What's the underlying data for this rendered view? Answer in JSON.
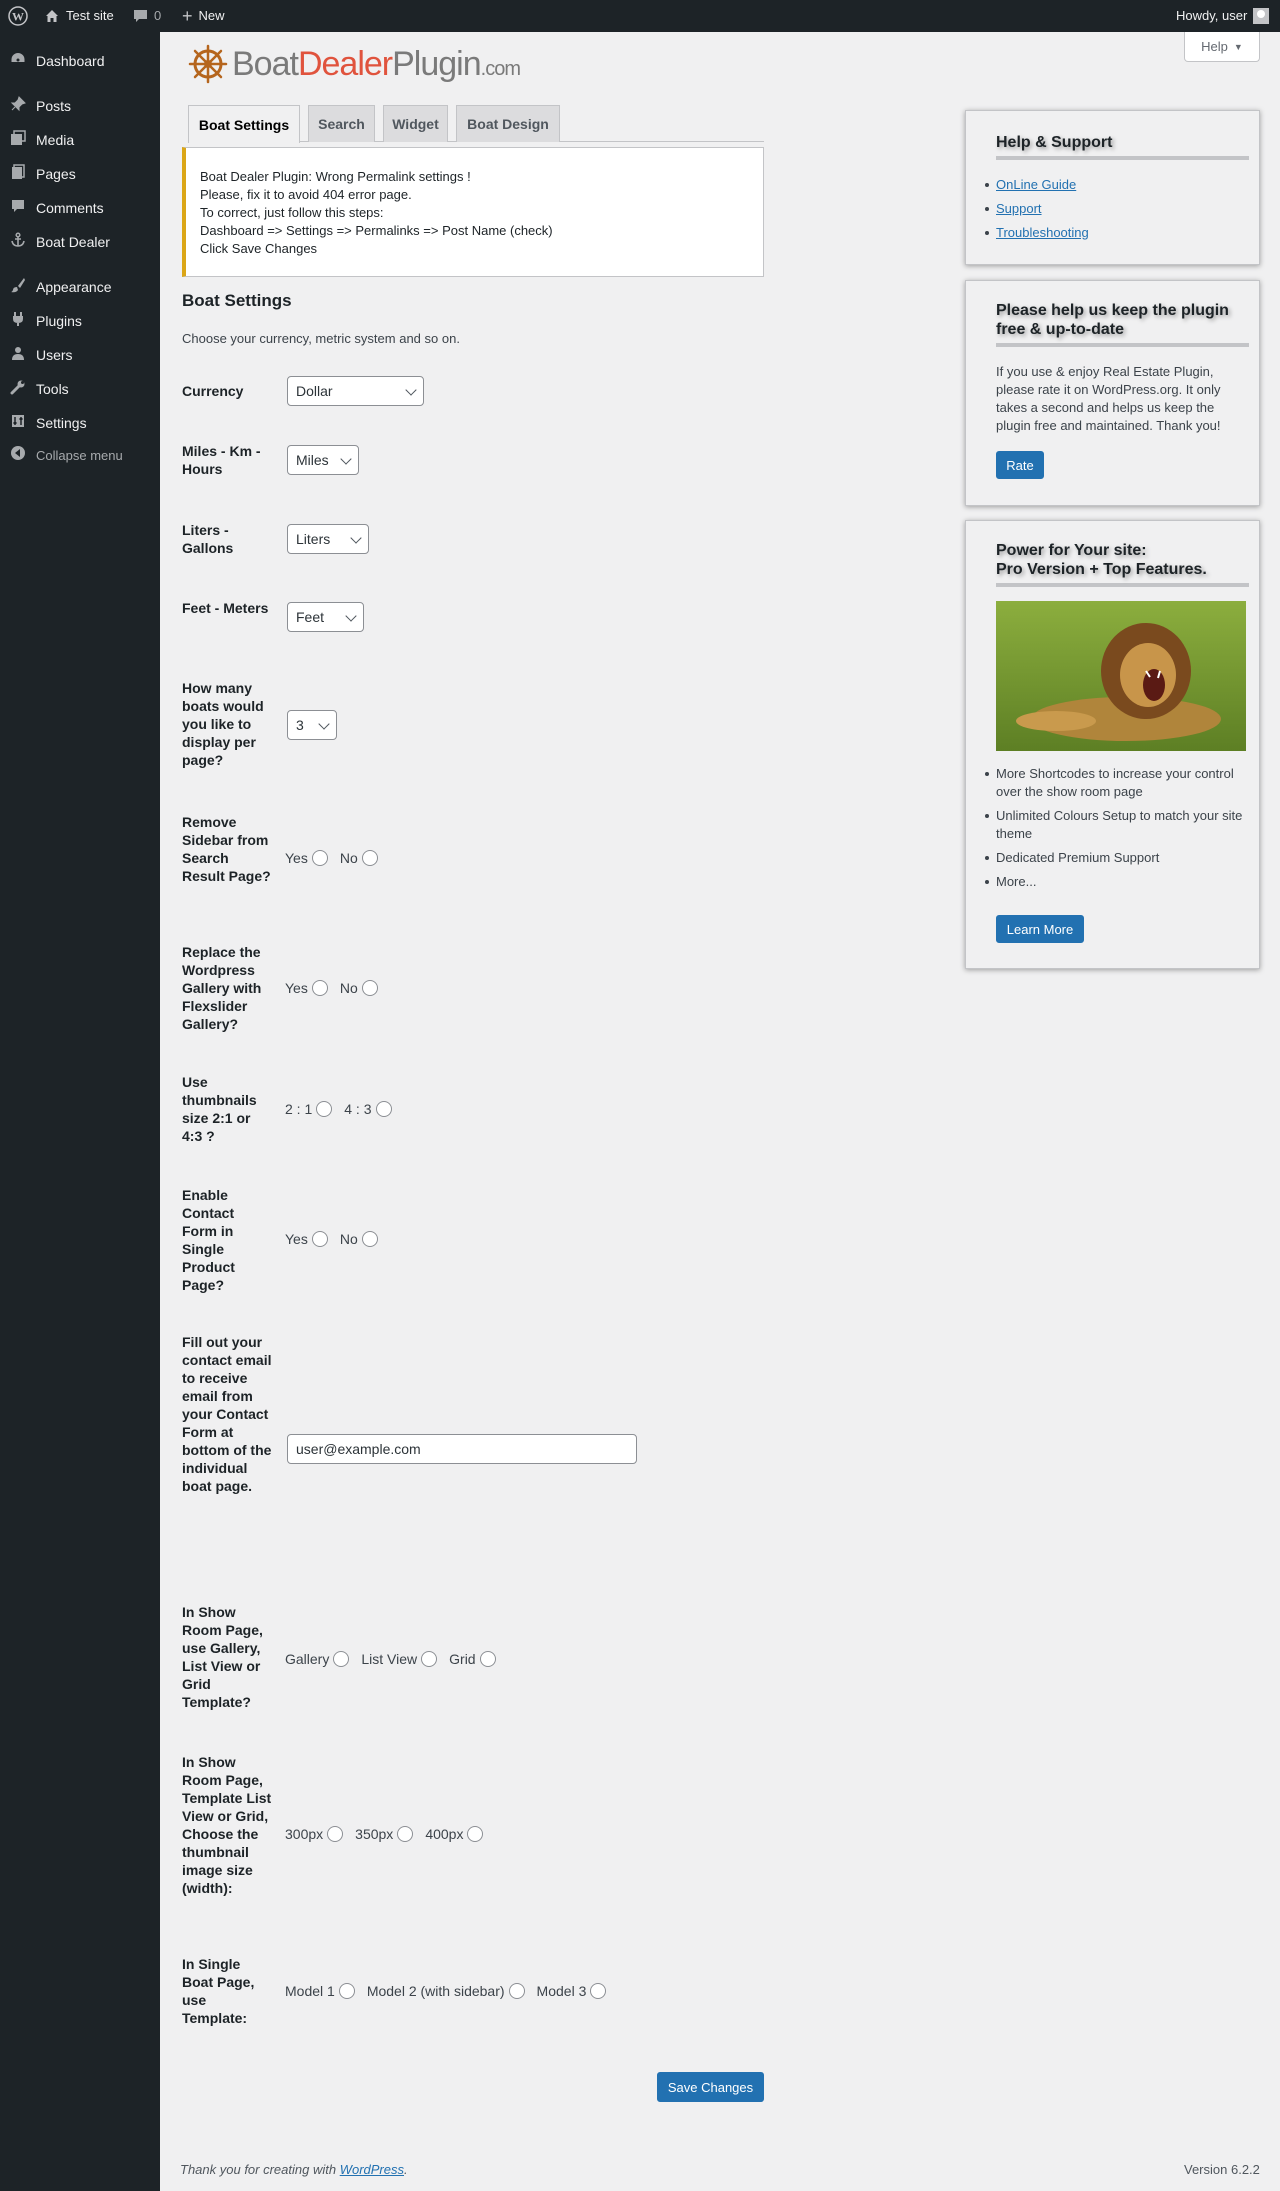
{
  "adminbar": {
    "site_name": "Test site",
    "comments_count": "0",
    "new_label": "New",
    "howdy": "Howdy, user"
  },
  "sidebar": {
    "items": [
      {
        "label": "Dashboard",
        "icon": "dashboard-icon"
      },
      {
        "label": "Posts",
        "icon": "pin-icon"
      },
      {
        "label": "Media",
        "icon": "media-icon"
      },
      {
        "label": "Pages",
        "icon": "page-icon"
      },
      {
        "label": "Comments",
        "icon": "comment-icon"
      },
      {
        "label": "Boat Dealer",
        "icon": "anchor-icon"
      },
      {
        "label": "Appearance",
        "icon": "brush-icon"
      },
      {
        "label": "Plugins",
        "icon": "plug-icon"
      },
      {
        "label": "Users",
        "icon": "user-icon"
      },
      {
        "label": "Tools",
        "icon": "wrench-icon"
      },
      {
        "label": "Settings",
        "icon": "settings-icon"
      }
    ],
    "collapse_label": "Collapse menu"
  },
  "help_button": "Help",
  "logo": {
    "part1": "Boat",
    "part2": "Dealer",
    "part3": "Plugin",
    "part4": ".com"
  },
  "tabs": [
    "Boat Settings",
    "Search",
    "Widget",
    "Boat Design"
  ],
  "notice": {
    "lines": [
      "Boat Dealer Plugin: Wrong Permalink settings !",
      "Please, fix it to avoid 404 error page.",
      "To correct, just follow this steps:",
      "Dashboard => Settings => Permalinks => Post Name (check)",
      "Click Save Changes"
    ]
  },
  "settings": {
    "title": "Boat Settings",
    "description": "Choose your currency, metric system and so on.",
    "currency": {
      "label": "Currency",
      "value": "Dollar"
    },
    "miles": {
      "label": "Miles - Km - Hours",
      "value": "Miles"
    },
    "liters": {
      "label": "Liters - Gallons",
      "value": "Liters"
    },
    "feet": {
      "label": "Feet - Meters",
      "value": "Feet"
    },
    "per_page": {
      "label": "How many boats would you like to display per page?",
      "value": "3"
    },
    "remove_sidebar": {
      "label": "Remove Sidebar from Search Result Page?",
      "options": [
        "Yes",
        "No"
      ]
    },
    "replace_gallery": {
      "label": "Replace the Wordpress Gallery with Flexslider Gallery?",
      "options": [
        "Yes",
        "No"
      ]
    },
    "thumbnails": {
      "label": "Use thumbnails size 2:1 or 4:3 ?",
      "options": [
        "2 : 1",
        "4 : 3"
      ]
    },
    "contact_form": {
      "label": "Enable Contact Form in Single Product Page?",
      "options": [
        "Yes",
        "No"
      ]
    },
    "contact_email": {
      "label": "Fill out your contact email to receive email from your Contact Form at bottom of the individual boat page.",
      "value": "user@example.com"
    },
    "showroom_template": {
      "label": "In Show Room Page, use Gallery, List View or Grid Template?",
      "options": [
        "Gallery",
        "List View",
        "Grid"
      ]
    },
    "thumb_size": {
      "label": "In Show Room Page, Template List View or Grid, Choose the thumbnail image size (width):",
      "options": [
        "300px",
        "350px",
        "400px"
      ]
    },
    "single_template": {
      "label": "In Single Boat Page, use Template:",
      "options": [
        "Model 1",
        "Model 2 (with sidebar)",
        "Model 3"
      ]
    },
    "save_label": "Save Changes"
  },
  "help_box": {
    "title": "Help & Support",
    "links": [
      "OnLine Guide",
      "Support",
      "Troubleshooting"
    ]
  },
  "rate_box": {
    "title": "Please help us keep the plugin free & up-to-date",
    "text": "If you use & enjoy Real Estate Plugin, please rate it on WordPress.org. It only takes a second and helps us keep the plugin free and maintained. Thank you!",
    "button": "Rate"
  },
  "pro_box": {
    "title_line1": "Power for Your site:",
    "title_line2": "Pro Version + Top Features.",
    "features": [
      "More Shortcodes to increase your control over the show room page",
      "Unlimited Colours Setup to match your site theme",
      "Dedicated Premium Support",
      "More..."
    ],
    "button": "Learn More"
  },
  "footer": {
    "thanks_prefix": "Thank you for creating with ",
    "thanks_link": "WordPress",
    "thanks_suffix": ".",
    "version": "Version 6.2.2"
  }
}
